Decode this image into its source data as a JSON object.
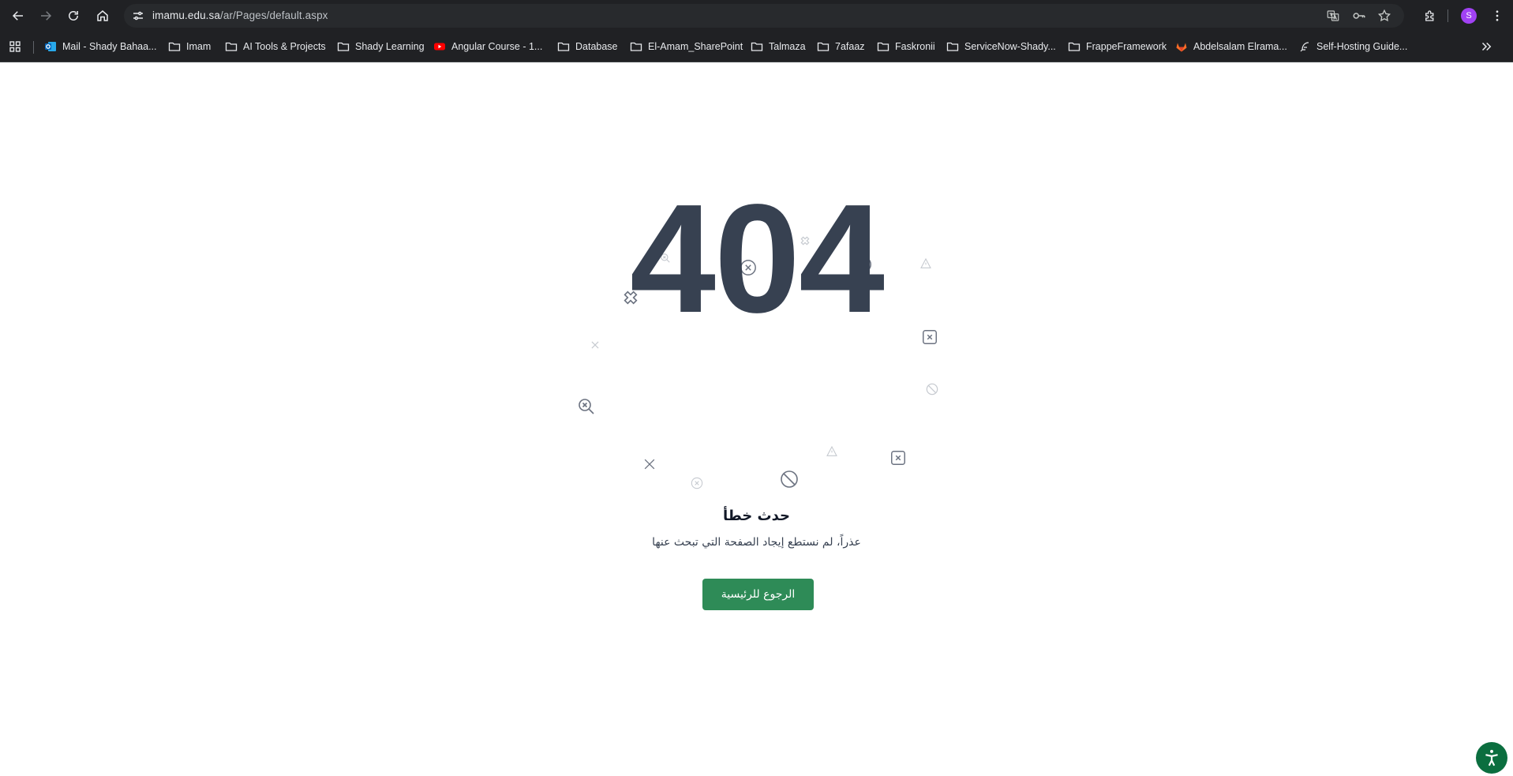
{
  "browser": {
    "url_host": "imamu.edu.sa",
    "url_path": "/ar/Pages/default.aspx",
    "profile_initial": "S",
    "icons": {
      "back": "arrow-left-icon",
      "forward": "arrow-right-icon",
      "reload": "reload-icon",
      "home": "home-icon",
      "site_info": "tune-icon",
      "translate": "translate-icon",
      "password": "key-icon",
      "bookmark": "star-icon",
      "extensions": "puzzle-icon",
      "menu": "kebab-icon"
    }
  },
  "bookmarks": [
    {
      "label": "Mail - Shady Bahaa...",
      "icon": "outlook-icon"
    },
    {
      "label": "Imam",
      "icon": "folder-icon"
    },
    {
      "label": "AI Tools & Projects",
      "icon": "folder-icon"
    },
    {
      "label": "Shady Learning",
      "icon": "folder-icon"
    },
    {
      "label": "Angular Course - 1...",
      "icon": "youtube-icon"
    },
    {
      "label": "Database",
      "icon": "folder-icon"
    },
    {
      "label": "El-Amam_SharePoint",
      "icon": "folder-icon"
    },
    {
      "label": "Talmaza",
      "icon": "folder-icon"
    },
    {
      "label": "7afaaz",
      "icon": "folder-icon"
    },
    {
      "label": "Faskronii",
      "icon": "folder-icon"
    },
    {
      "label": "ServiceNow-Shady...",
      "icon": "folder-icon"
    },
    {
      "label": "FrappeFramework",
      "icon": "folder-icon"
    },
    {
      "label": "Abdelsalam Elrama...",
      "icon": "gitlab-icon"
    },
    {
      "label": "Self-Hosting Guide...",
      "icon": "feather-icon"
    }
  ],
  "page": {
    "code": "404",
    "title": "حدث خطأ",
    "message": "عذراً، لم نستطع إيجاد الصفحة التي تبحث عنها",
    "button_label": "الرجوع للرئيسية",
    "brand_color": "#2e8b57",
    "code_color": "#374151"
  }
}
